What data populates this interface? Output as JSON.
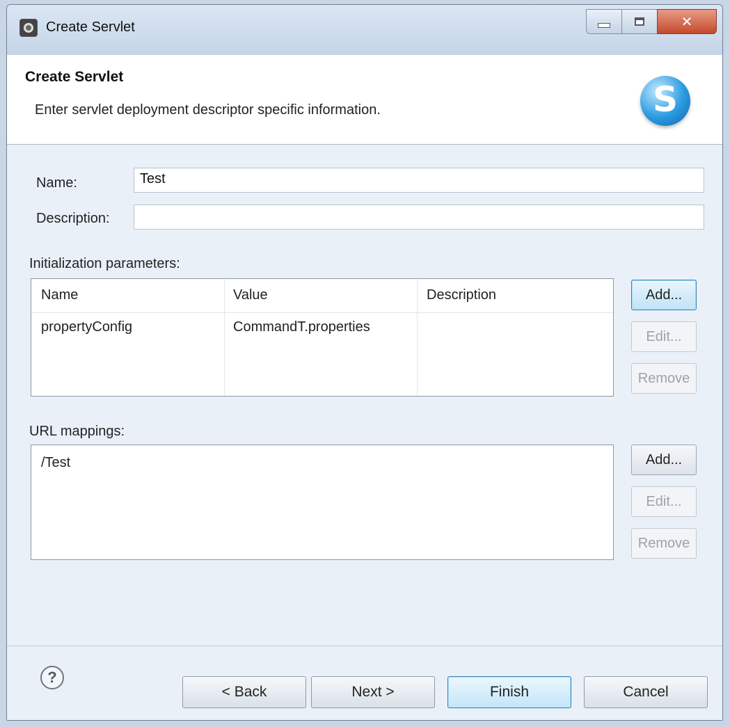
{
  "window": {
    "title": "Create Servlet"
  },
  "header": {
    "title": "Create Servlet",
    "description": "Enter servlet deployment descriptor specific information.",
    "logo_letter": "S"
  },
  "form": {
    "name_label": "Name:",
    "name_value": "Test",
    "description_label": "Description:",
    "description_value": ""
  },
  "init_params": {
    "label": "Initialization parameters:",
    "columns": [
      "Name",
      "Value",
      "Description"
    ],
    "rows": [
      {
        "name": "propertyConfig",
        "value": "CommandT.properties",
        "description": ""
      }
    ],
    "buttons": {
      "add": "Add...",
      "edit": "Edit...",
      "remove": "Remove"
    }
  },
  "url_mappings": {
    "label": "URL mappings:",
    "items": [
      "/Test"
    ],
    "buttons": {
      "add": "Add...",
      "edit": "Edit...",
      "remove": "Remove"
    }
  },
  "footer": {
    "help_glyph": "?",
    "back": "< Back",
    "next": "Next >",
    "finish": "Finish",
    "cancel": "Cancel"
  },
  "icons": {
    "app": "servlet-app-icon",
    "logo": "servlet-s-logo-icon",
    "help": "help-icon",
    "minimize": "minimize-icon",
    "maximize": "maximize-icon",
    "close": "close-icon"
  },
  "colors": {
    "close_button": "#c44a2c",
    "default_button": "#3c7fb1",
    "logo": "#2b9be0"
  }
}
